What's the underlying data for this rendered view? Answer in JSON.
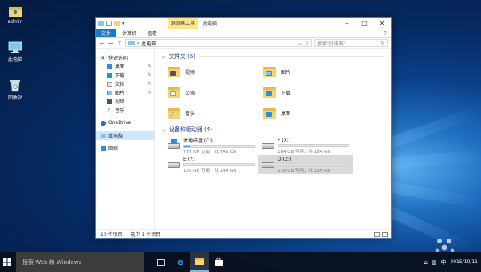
{
  "desktop": {
    "icons": [
      {
        "label": "admin",
        "icon": "user-folder-icon"
      },
      {
        "label": "此电脑",
        "icon": "computer-icon"
      },
      {
        "label": "回收站",
        "icon": "recycle-bin-icon"
      }
    ]
  },
  "window": {
    "tool_tab": "驱动器工具",
    "title": "此电脑",
    "ribbon_tabs": [
      "文件",
      "计算机",
      "查看"
    ],
    "address": "此电脑",
    "search_placeholder": "搜索\"此电脑\"",
    "sidebar": {
      "quick_access": "快速访问",
      "pinned": [
        "桌面",
        "下载",
        "文档",
        "图片"
      ],
      "recent": [
        "视频",
        "音乐"
      ],
      "onedrive": "OneDrive",
      "this_pc": "此电脑",
      "network": "网络"
    },
    "folders_header": "文件夹 (6)",
    "folders": [
      "视频",
      "图片",
      "文档",
      "下载",
      "音乐",
      "桌面"
    ],
    "drives_header": "设备和驱动器 (4)",
    "drives": [
      {
        "name": "本地磁盘 (C:)",
        "size": "171 GB 可用，共 186 GB",
        "used_fraction": 0.08,
        "selected": false
      },
      {
        "name": "F (X:)",
        "size": "184 GB 可用，共 184 GB",
        "used_fraction": 0.0,
        "selected": false
      },
      {
        "name": "E (Y:)",
        "size": "139 GB 可用，共 140 GB",
        "used_fraction": 0.0,
        "selected": false
      },
      {
        "name": "D (Z:)",
        "size": "139 GB 可用，共 139 GB",
        "used_fraction": 0.0,
        "selected": true
      }
    ],
    "status_count": "10 个项目",
    "status_selected": "选中 1 个项目"
  },
  "taskbar": {
    "search_text": "搜索 Web 和 Windows",
    "ime": "中",
    "date": "2015/10/11"
  }
}
